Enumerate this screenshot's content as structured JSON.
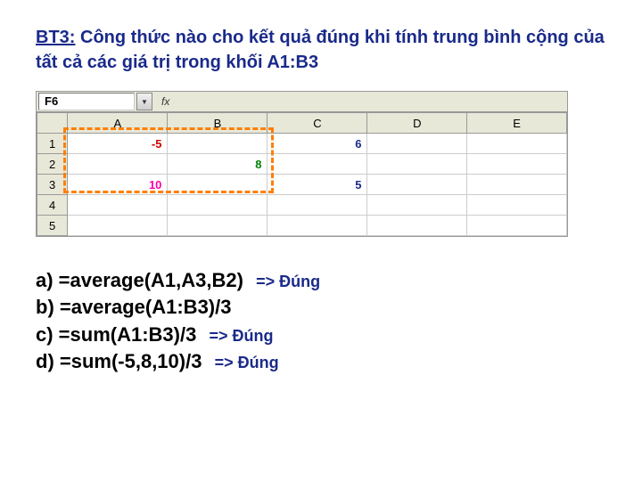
{
  "title": {
    "prefix": "BT3:",
    "rest": " Công thức nào cho kết quả đúng khi tính trung bình cộng của tất cả các giá trị trong khối A1:B3"
  },
  "spreadsheet": {
    "active_cell": "F6",
    "fx_label": "fx",
    "columns": [
      "A",
      "B",
      "C",
      "D",
      "E"
    ],
    "rows": [
      "1",
      "2",
      "3",
      "4",
      "5"
    ],
    "cells": {
      "A1": {
        "value": "-5",
        "class": "val-red"
      },
      "C1": {
        "value": "6",
        "class": "val-blue"
      },
      "B2": {
        "value": "8",
        "class": "val-green"
      },
      "A3": {
        "value": "10",
        "class": "val-pink"
      },
      "C3": {
        "value": "5",
        "class": "val-blue"
      }
    }
  },
  "answers": {
    "a": {
      "text": "a) =average(A1,A3,B2)",
      "correct": "=> Đúng"
    },
    "b": {
      "text": "b) =average(A1:B3)/3",
      "correct": ""
    },
    "c": {
      "text": "c) =sum(A1:B3)/3",
      "correct": "=> Đúng"
    },
    "d": {
      "text": "d) =sum(-5,8,10)/3",
      "correct": "=> Đúng"
    }
  }
}
